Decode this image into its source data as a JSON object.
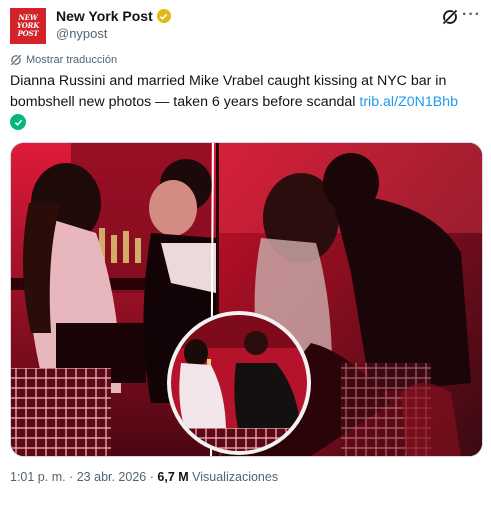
{
  "account": {
    "display_name": "New York Post",
    "handle": "@nypost",
    "avatar_lines": [
      "NEW",
      "YORK",
      "POST"
    ]
  },
  "translate_label": "Mostrar traducción",
  "tweet": {
    "text": "Dianna Russini and married Mike Vrabel caught kissing at NYC bar in bombshell new photos — taken 6 years before scandal",
    "link": "trib.al/Z0N1Bhb"
  },
  "meta": {
    "time": "1:01 p. m.",
    "separator": "·",
    "date": "23 abr. 2026",
    "views_count": "6,7 M",
    "views_label": "Visualizaciones"
  },
  "colors": {
    "brand_red": "#d2232a",
    "verified_gold": "#e2b719",
    "link_blue": "#1d9bf0",
    "muted": "#536471"
  },
  "icons": [
    "verified-badge-icon",
    "grok-icon",
    "more-icon",
    "translate-icon",
    "check-circle-icon"
  ]
}
